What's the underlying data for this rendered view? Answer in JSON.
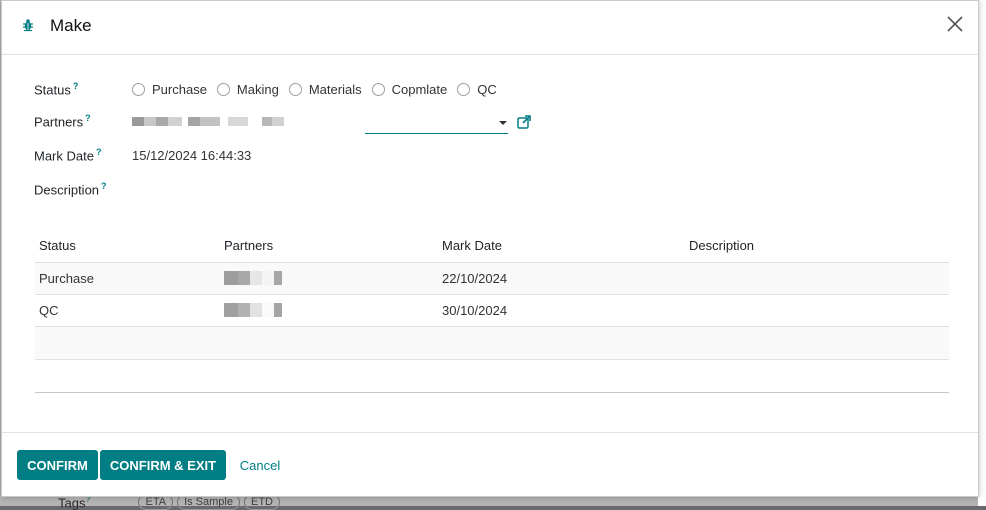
{
  "dialog": {
    "title": "Make",
    "icon": "bug-icon",
    "accent_color": "#017e84"
  },
  "form": {
    "status": {
      "label": "Status",
      "help": "?",
      "options": [
        "Purchase",
        "Making",
        "Materials",
        "Copmlate",
        "QC"
      ]
    },
    "partners": {
      "label": "Partners",
      "help": "?",
      "value": ""
    },
    "mark_date": {
      "label": "Mark Date",
      "help": "?",
      "value": "15/12/2024 16:44:33"
    },
    "description": {
      "label": "Description",
      "help": "?"
    }
  },
  "table": {
    "columns": [
      "Status",
      "Partners",
      "Mark Date",
      "Description"
    ],
    "rows": [
      {
        "status": "Purchase",
        "partners": "",
        "mark_date": "22/10/2024",
        "description": ""
      },
      {
        "status": "QC",
        "partners": "",
        "mark_date": "30/10/2024",
        "description": ""
      }
    ]
  },
  "footer": {
    "confirm": "CONFIRM",
    "confirm_exit": "CONFIRM & EXIT",
    "cancel": "Cancel"
  },
  "background": {
    "tags_label": "Tags",
    "tags_help": "?",
    "tags": [
      "ETA",
      "Is Sample",
      "ETD"
    ]
  }
}
